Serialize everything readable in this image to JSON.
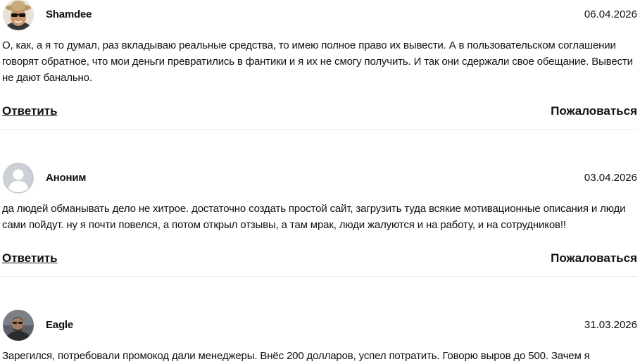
{
  "comments": [
    {
      "author": "Shamdee",
      "date": "06.04.2026",
      "avatar_icon": "user-photo-sunglasses-hat",
      "text": "О, как, а я то думал, раз вкладываю реальные средства, то имею полное право их вывести. А в пользовательском соглашении говорят обратное, что мои деньги превратились в фантики и я их не смогу получить. И так они сдержали свое обещание. Вывести не дают банально.",
      "reply_label": "Ответить",
      "complain_label": "Пожаловаться"
    },
    {
      "author": "Аноним",
      "date": "03.04.2026",
      "avatar_icon": "default-user-icon",
      "text": "да людей обманывать дело не хитрое. достаточно создать простой сайт, загрузить туда всякие мотивационные описания и люди сами пойдут. ну я почти повелся, а потом открыл отзывы, а там мрак, люди жалуются и на работу, и на сотрудников!!",
      "reply_label": "Ответить",
      "complain_label": "Пожаловаться"
    },
    {
      "author": "Eagle",
      "date": "31.03.2026",
      "avatar_icon": "user-photo-dark",
      "text": "Зарегился, потребовали промокод дали менеджеры. Внёс 200 долларов, успел потратить. Говорю выров до 500. Зачем я"
    }
  ]
}
